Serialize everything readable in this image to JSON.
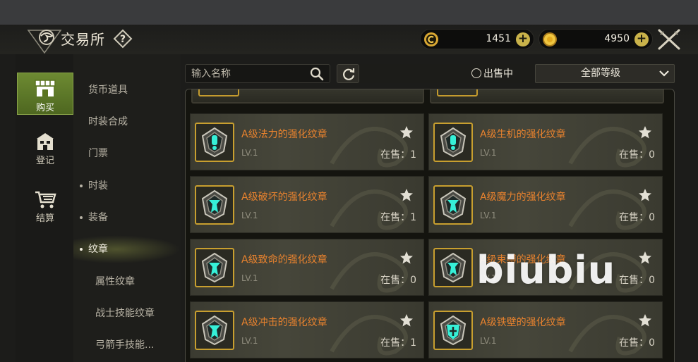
{
  "header": {
    "title": "交易所",
    "currency": [
      {
        "icon": "gold-c-coin-icon",
        "value": "1451"
      },
      {
        "icon": "gold-coin-icon",
        "value": "4950"
      }
    ]
  },
  "nav": [
    {
      "label": "购买",
      "icon": "shop-icon",
      "active": true
    },
    {
      "label": "登记",
      "icon": "register-icon",
      "active": false
    },
    {
      "label": "结算",
      "icon": "cart-icon",
      "active": false
    }
  ],
  "categories": [
    {
      "label": "货币道具"
    },
    {
      "label": "时装合成"
    },
    {
      "label": "门票"
    },
    {
      "label": "时装",
      "dot": true
    },
    {
      "label": "装备",
      "dot": true
    },
    {
      "label": "纹章",
      "dot": true,
      "active": true
    },
    {
      "label": "属性纹章",
      "sub": true
    },
    {
      "label": "战士技能纹章",
      "sub": true
    },
    {
      "label": "弓箭手技能...",
      "sub": true
    }
  ],
  "filters": {
    "search_placeholder": "输入名称",
    "on_sale_label": "出售中",
    "grade_select": "全部等级"
  },
  "items": [
    {
      "name": "A级法力的强化纹章",
      "level": "LV.1",
      "on_sale": "在售：1"
    },
    {
      "name": "A级生机的强化纹章",
      "level": "LV.1",
      "on_sale": "在售：0"
    },
    {
      "name": "A级破坏的强化纹章",
      "level": "LV.1",
      "on_sale": "在售：1"
    },
    {
      "name": "A级魔力的强化纹章",
      "level": "LV.1",
      "on_sale": "在售：0"
    },
    {
      "name": "A级致命的强化纹章",
      "level": "LV.1",
      "on_sale": "在售：0"
    },
    {
      "name": "A级束缚的强化纹章",
      "level": "LV.1",
      "on_sale": "在售：0"
    },
    {
      "name": "A级冲击的强化纹章",
      "level": "LV.1",
      "on_sale": "在售：1"
    },
    {
      "name": "A级铁壁的强化纹章",
      "level": "LV.1",
      "on_sale": "在售：0"
    }
  ],
  "watermark": "biubiu",
  "colors": {
    "accent_green": "#6d8a32",
    "item_name": "#e8822e",
    "frame_gold": "#c89f2f"
  }
}
